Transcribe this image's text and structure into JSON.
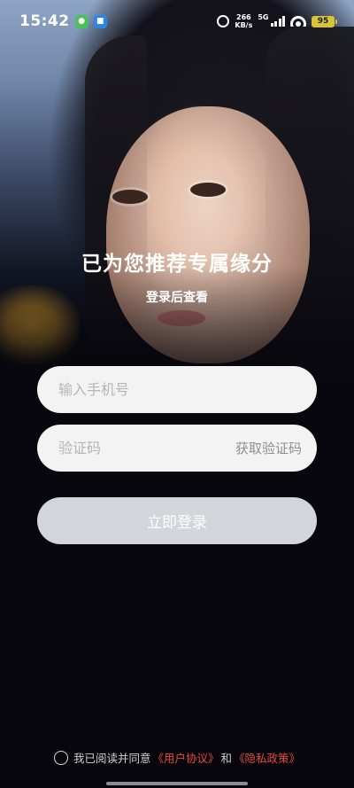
{
  "status_bar": {
    "time": "15:42",
    "net_speed_value": "266",
    "net_speed_unit": "KB/s",
    "network_type": "5G",
    "battery_level": "95"
  },
  "hero": {
    "headline": "已为您推荐专属缘分",
    "subline": "登录后查看"
  },
  "form": {
    "phone_placeholder": "输入手机号",
    "code_placeholder": "验证码",
    "get_code_label": "获取验证码",
    "login_label": "立即登录"
  },
  "agreement": {
    "prefix": "我已阅读并同意",
    "user_agreement": "《用户协议》",
    "conjunction": "和",
    "privacy_policy": "《隐私政策》"
  },
  "colors": {
    "accent_link": "#e74a3c",
    "login_button_disabled": "#d2d5da",
    "input_background": "#f3f3f3"
  }
}
